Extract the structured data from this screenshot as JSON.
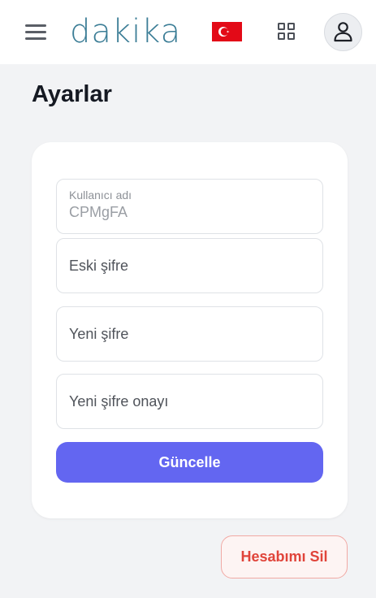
{
  "header": {
    "logo_text": "dakika",
    "flag_icon": "turkey-flag-icon",
    "colors": {
      "logo": "#3b7d96",
      "flag_red": "#e30a17"
    }
  },
  "page": {
    "title": "Ayarlar"
  },
  "form": {
    "username": {
      "label": "Kullanıcı adı",
      "value": "CPMgFA"
    },
    "old_password": {
      "placeholder": "Eski şifre"
    },
    "new_password": {
      "placeholder": "Yeni şifre"
    },
    "confirm_password": {
      "placeholder": "Yeni şifre onayı"
    },
    "submit_label": "Güncelle"
  },
  "danger": {
    "delete_label": "Hesabımı Sil"
  },
  "colors": {
    "primary": "#6366f1",
    "danger": "#e0443a",
    "background": "#f2f3f5"
  }
}
